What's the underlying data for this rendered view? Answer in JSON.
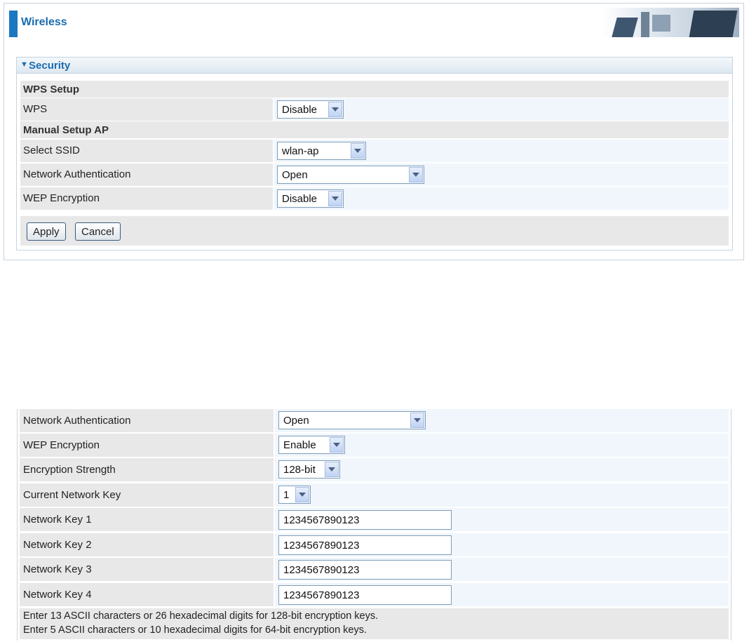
{
  "header": {
    "title": "Wireless"
  },
  "section": {
    "title": "Security",
    "wps_setup_label": "WPS Setup",
    "wps": {
      "label": "WPS",
      "value": "Disable"
    },
    "manual_setup_label": "Manual Setup AP",
    "ssid": {
      "label": "Select SSID",
      "value": "wlan-ap"
    },
    "auth": {
      "label": "Network Authentication",
      "value": "Open"
    },
    "wep": {
      "label": "WEP Encryption",
      "value": "Disable"
    },
    "apply_label": "Apply",
    "cancel_label": "Cancel"
  },
  "detail": {
    "auth": {
      "label": "Network Authentication",
      "value": "Open"
    },
    "wep": {
      "label": "WEP Encryption",
      "value": "Enable"
    },
    "strength": {
      "label": "Encryption Strength",
      "value": "128-bit"
    },
    "current_key": {
      "label": "Current Network Key",
      "value": "1"
    },
    "keys": [
      {
        "label": "Network Key 1",
        "value": "1234567890123"
      },
      {
        "label": "Network Key 2",
        "value": "1234567890123"
      },
      {
        "label": "Network Key 3",
        "value": "1234567890123"
      },
      {
        "label": "Network Key 4",
        "value": "1234567890123"
      }
    ],
    "note_line1": "Enter 13 ASCII characters or 26 hexadecimal digits for 128-bit encryption keys.",
    "note_line2": "Enter 5 ASCII characters or 10 hexadecimal digits for 64-bit encryption keys."
  },
  "colors": {
    "accent": "#1a6cb0",
    "label_bg": "#e8e8e8",
    "value_bg": "#f0f6fc"
  }
}
